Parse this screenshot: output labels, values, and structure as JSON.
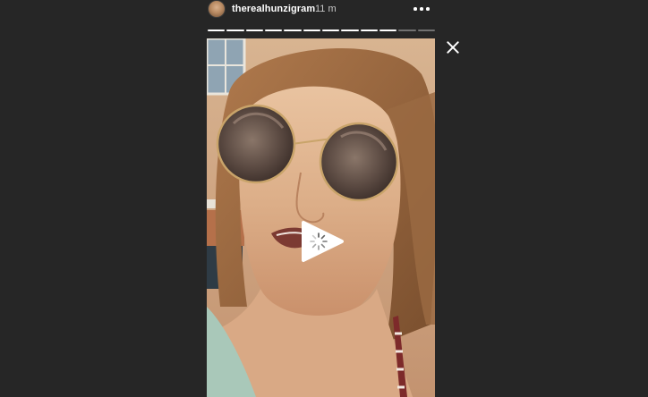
{
  "story": {
    "username": "therealhunzigram",
    "time_ago": "11 m",
    "segment_count": 12,
    "active_segment_index": 10,
    "active_segment_progress": 0.0
  },
  "icons": {
    "more": "more-horizontal-icon",
    "close": "close-icon",
    "play": "play-icon",
    "loading": "loading-spinner-icon"
  },
  "colors": {
    "background": "#262626",
    "text_primary": "#ffffff",
    "text_secondary": "#c7c7c7"
  }
}
